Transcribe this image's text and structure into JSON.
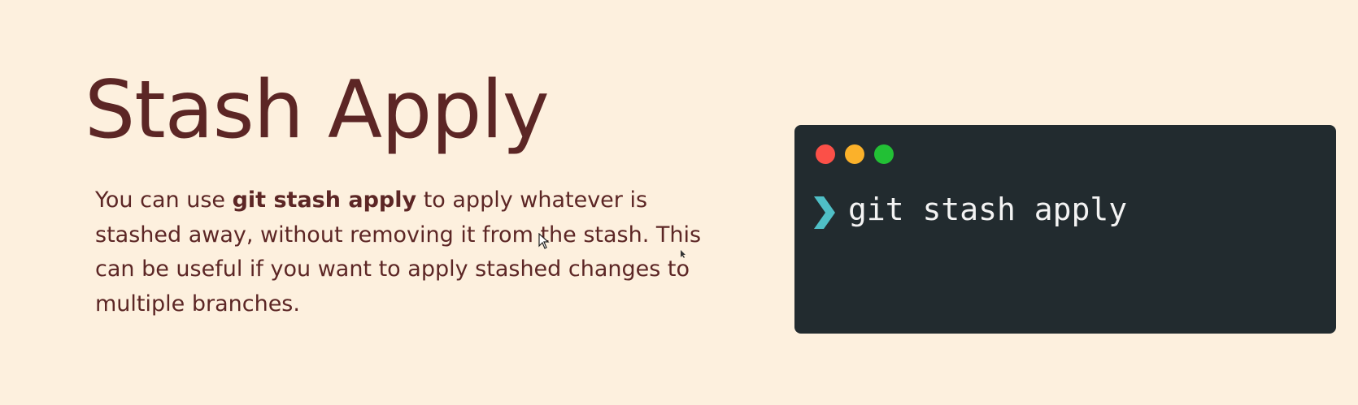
{
  "slide": {
    "title": "Stash Apply",
    "description": {
      "before": "You can use ",
      "bold": "git stash apply",
      "after": " to apply whatever is stashed away, without removing it from the stash. This can be useful if you want to apply stashed changes to multiple branches."
    }
  },
  "terminal": {
    "window_dots": [
      "close-dot",
      "minimize-dot",
      "maximize-dot"
    ],
    "prompt_icon": "chevron-right-icon",
    "command": "git stash apply"
  },
  "colors": {
    "background": "#fdf0de",
    "title": "#5c2625",
    "terminal_bg": "#222b2f",
    "prompt": "#4fbfc6",
    "dot_red": "#fb5048",
    "dot_yellow": "#fbb12a",
    "dot_green": "#22c035"
  }
}
